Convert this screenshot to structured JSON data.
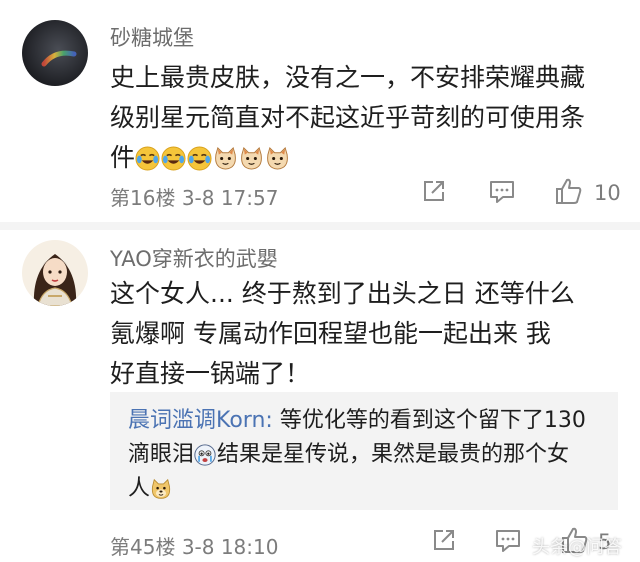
{
  "comments": [
    {
      "username": "砂糖城堡",
      "lines": [
        "史上最贵皮肤，没有之一，不安排荣耀典藏",
        "级别星元简直对不起这近乎苛刻的可使用条",
        "件"
      ],
      "emojis": [
        "face-with-tears-emoji",
        "face-with-tears-emoji",
        "face-with-tears-emoji",
        "cat-face-emoji",
        "cat-face-emoji",
        "cat-face-emoji"
      ],
      "floor": "第16楼",
      "date": "3-8 17:57",
      "like_count": "10"
    },
    {
      "username": "YAO穿新衣的武嬰",
      "lines": [
        "这个女人... 终于熬到了出头之日   还等什么",
        "氪爆啊  专属动作回程望也能一起出来   我",
        "好直接一锅端了！"
      ],
      "reply": {
        "author": "晨词滥调Korn",
        "separator": ":",
        "line1": " 等优化等的看到这个留下了130",
        "line2_a": "滴眼泪",
        "line2_b": "结果是星传说，果然是最贵的那个女",
        "line3": "人",
        "emojis": [
          "crying-face-emoji",
          "doge-emoji"
        ]
      },
      "floor": "第45楼",
      "date": "3-8 18:10",
      "like_count": "5"
    }
  ],
  "watermark": "头条@问答",
  "icons": {
    "share": "share-icon",
    "comment": "comment-icon",
    "like": "thumbs-up-icon"
  },
  "colors": {
    "reply_author": "#4b73b3",
    "meta_text": "#7c7c7c",
    "quote_bg": "#f3f3f3"
  }
}
